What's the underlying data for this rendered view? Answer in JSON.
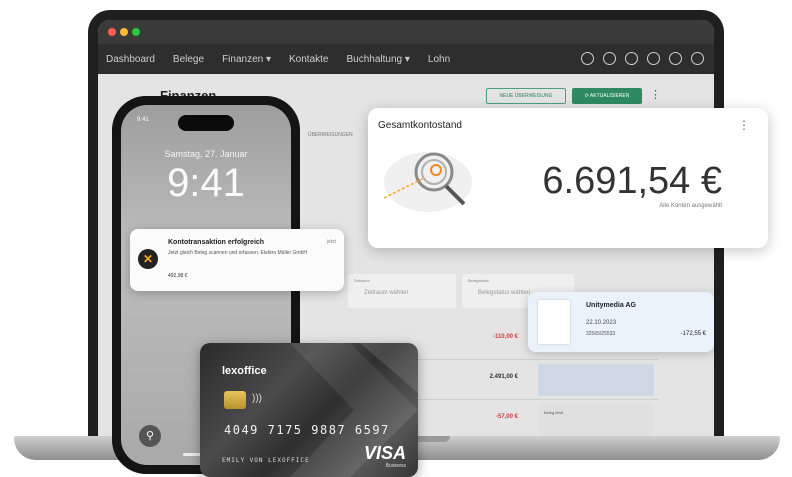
{
  "app": {
    "nav": [
      "Dashboard",
      "Belege",
      "Finanzen ▾",
      "Kontakte",
      "Buchhaltung ▾",
      "Lohn"
    ],
    "icons": [
      "heart-icon",
      "plus-circle-icon",
      "help-icon",
      "search-icon",
      "settings-icon",
      "user-icon"
    ],
    "window_dots": [
      "#ff5f57",
      "#febc2e",
      "#28c840"
    ],
    "page_title": "Finanzen",
    "btn_new": "NEUE ÜBERWEISUNG",
    "btn_update": "⟳ AKTUALISIEREN",
    "sub_tab": "ÜBERWEISUNGEN",
    "filter1_label": "Zeitraum",
    "filter1_value": "Zeitraum wählen",
    "filter2_label": "Belegstatus",
    "filter2_value": "Belegstatus wählen",
    "rows": [
      {
        "amount": "-110,00 €",
        "negative": true
      },
      {
        "amount": "2.491,00 €",
        "negative": false
      },
      {
        "amount": "-57,00 €",
        "negative": true
      }
    ],
    "row_side": [
      "",
      "",
      "Beleg fehlt"
    ]
  },
  "balance_card": {
    "title": "Gesamtkontostand",
    "amount": "6.691,54 €",
    "subtitle": "Alle Konten ausgewählt",
    "menu": "⋮"
  },
  "phone": {
    "status_time": "9:41",
    "date": "Samstag, 27. Januar",
    "time": "9:41"
  },
  "notification": {
    "icon": "✕",
    "title": "Kontotransaktion erfolgreich",
    "time": "jetzt",
    "text": "Jetzt gleich Beleg scannen und erfassen. Elektro Müller GmbH",
    "amount": "492,98 €"
  },
  "transaction": {
    "name": "Unitymedia AG",
    "date": "22.10.2023",
    "ref": "32565/25533",
    "amount": "-172,55 €"
  },
  "credit_card": {
    "brand": "lexoffice",
    "number": "4049 7175 9887 6597",
    "holder": "EMILY VON LEXOFFICE",
    "network": "VISA",
    "network_sub": "Business",
    "nfc": "))) "
  }
}
